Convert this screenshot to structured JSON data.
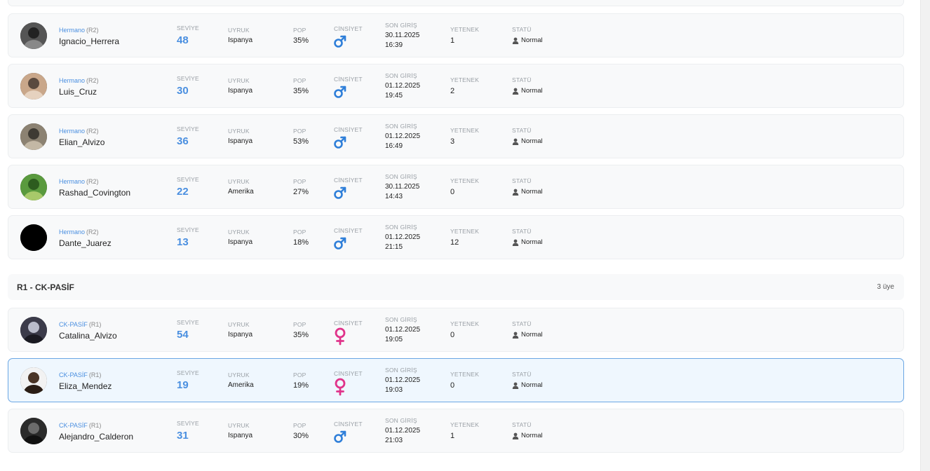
{
  "labels": {
    "level": "SEVİYE",
    "nationality": "UYRUK",
    "pop": "POP",
    "gender": "CİNSİYET",
    "last_login": "SON GİRİŞ",
    "skill": "YETENEK",
    "status": "STATÜ"
  },
  "colors": {
    "accent": "#4a8fe0",
    "male": "#2f7fd9",
    "female": "#e0338a",
    "selected_border": "#6aa6e4"
  },
  "group": {
    "title": "R1 - CK-PASİF",
    "count": "3 üye"
  },
  "members": [
    {
      "rank": "Hermano",
      "rank_code": "(R2)",
      "name": "Ignacio_Herrera",
      "level": "48",
      "nationality": "Ispanya",
      "pop": "35%",
      "gender": "male",
      "gender_icon": "male-icon",
      "last_login_date": "30.11.2025",
      "last_login_time": "16:39",
      "skill": "1",
      "status": "Normal"
    },
    {
      "rank": "Hermano",
      "rank_code": "(R2)",
      "name": "Luis_Cruz",
      "level": "30",
      "nationality": "Ispanya",
      "pop": "35%",
      "gender": "male",
      "gender_icon": "male-icon",
      "last_login_date": "01.12.2025",
      "last_login_time": "19:45",
      "skill": "2",
      "status": "Normal"
    },
    {
      "rank": "Hermano",
      "rank_code": "(R2)",
      "name": "Elian_Alvizo",
      "level": "36",
      "nationality": "Ispanya",
      "pop": "53%",
      "gender": "male",
      "gender_icon": "male-icon",
      "last_login_date": "01.12.2025",
      "last_login_time": "16:49",
      "skill": "3",
      "status": "Normal"
    },
    {
      "rank": "Hermano",
      "rank_code": "(R2)",
      "name": "Rashad_Covington",
      "level": "22",
      "nationality": "Amerika",
      "pop": "27%",
      "gender": "male",
      "gender_icon": "male-icon",
      "last_login_date": "30.11.2025",
      "last_login_time": "14:43",
      "skill": "0",
      "status": "Normal"
    },
    {
      "rank": "Hermano",
      "rank_code": "(R2)",
      "name": "Dante_Juarez",
      "level": "13",
      "nationality": "Ispanya",
      "pop": "18%",
      "gender": "male",
      "gender_icon": "male-icon",
      "last_login_date": "01.12.2025",
      "last_login_time": "21:15",
      "skill": "12",
      "status": "Normal"
    },
    {
      "rank": "CK-PASİF",
      "rank_code": "(R1)",
      "name": "Catalina_Alvizo",
      "level": "54",
      "nationality": "Ispanya",
      "pop": "35%",
      "gender": "female",
      "gender_icon": "female-icon",
      "last_login_date": "01.12.2025",
      "last_login_time": "19:05",
      "skill": "0",
      "status": "Normal"
    },
    {
      "rank": "CK-PASİF",
      "rank_code": "(R1)",
      "name": "Eliza_Mendez",
      "level": "19",
      "nationality": "Amerika",
      "pop": "19%",
      "gender": "female",
      "gender_icon": "female-icon",
      "last_login_date": "01.12.2025",
      "last_login_time": "19:03",
      "skill": "0",
      "status": "Normal"
    },
    {
      "rank": "CK-PASİF",
      "rank_code": "(R1)",
      "name": "Alejandro_Calderon",
      "level": "31",
      "nationality": "Ispanya",
      "pop": "30%",
      "gender": "male",
      "gender_icon": "male-icon",
      "last_login_date": "01.12.2025",
      "last_login_time": "21:03",
      "skill": "1",
      "status": "Normal"
    }
  ]
}
